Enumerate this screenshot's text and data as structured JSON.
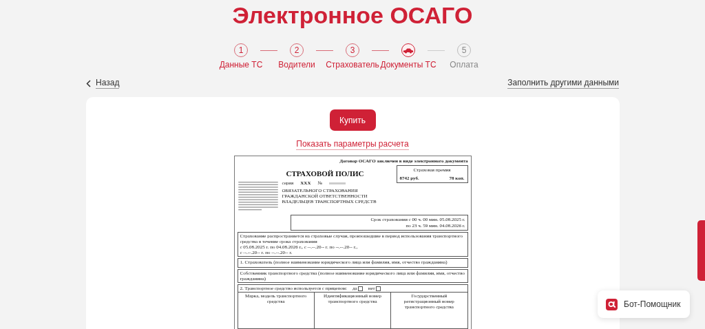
{
  "header": {
    "title": "Электронное ОСАГО"
  },
  "steps": [
    {
      "kind": "number",
      "number": "1",
      "label": "Данные ТС",
      "completed": true,
      "selected": false
    },
    {
      "kind": "number",
      "number": "2",
      "label": "Водители",
      "completed": true,
      "selected": false
    },
    {
      "kind": "number",
      "number": "3",
      "label": "Страхователь",
      "completed": true,
      "selected": false
    },
    {
      "kind": "car",
      "label": "Документы ТС",
      "completed": false,
      "selected": true
    },
    {
      "kind": "number",
      "number": "5",
      "label": "Оплата",
      "completed": false,
      "selected": false
    }
  ],
  "nav": {
    "back": "Назад",
    "fill_other": "Заполнить другими данными"
  },
  "card": {
    "buy_button": "Купить",
    "params_link": "Показать параметры расчета"
  },
  "policy": {
    "notice": "Договор ОСАГО заключен в виде электронного документа",
    "title": "СТРАХОВОЙ ПОЛИС",
    "premium_label": "Страховая премия",
    "premium_rub": "8742 руб.",
    "premium_kop": "78 коп.",
    "series_label": "серия",
    "series": "XXX",
    "number_label": "№",
    "subtitle": "ОБЯЗАТЕЛЬНОГО СТРАХОВАНИЯ ГРАЖДАНСКОЙ ОТВЕТСТВЕННОСТИ ВЛАДЕЛЬЦЕВ ТРАНСПОРТНЫХ СРЕДСТВ",
    "term_from": "Срок страхования с 00 ч. 00 мин. 05.08.2025 г.",
    "term_to": "по 23 ч. 59 мин. 04.08.2026 г.",
    "coverage_title": "Страхование распространяется на страховые случаи, произошедшие в период использования транспортного средства в течение срока страхования",
    "coverage_line_1": "с 05.08.2025 г. по 04.08.2026 г., с --.--.20-- г. по --.--.20-- г.,",
    "coverage_line_2": "с --.--.20-- г. по --.--.20-- г.",
    "insurer_label": "1. Страхователь (полное наименование юридического лица или фамилия, имя, отчество гражданина)",
    "owner_label": "Собственник транспортного средства (полное наименование юридического лица или фамилия, имя, отчество гражданина)",
    "trailer_label": "2. Транспортное средство используется с прицепом:",
    "trailer_options": [
      {
        "label": "да",
        "checked": false
      },
      {
        "label": "нет",
        "checked": false
      }
    ],
    "vehicle_columns": [
      "Марка, модель транспортного средства",
      "Идентификационный номер транспортного средства",
      "Государственный регистрационный номер транспортного средства"
    ]
  },
  "assistant": {
    "label": "Бот-Помощник"
  }
}
